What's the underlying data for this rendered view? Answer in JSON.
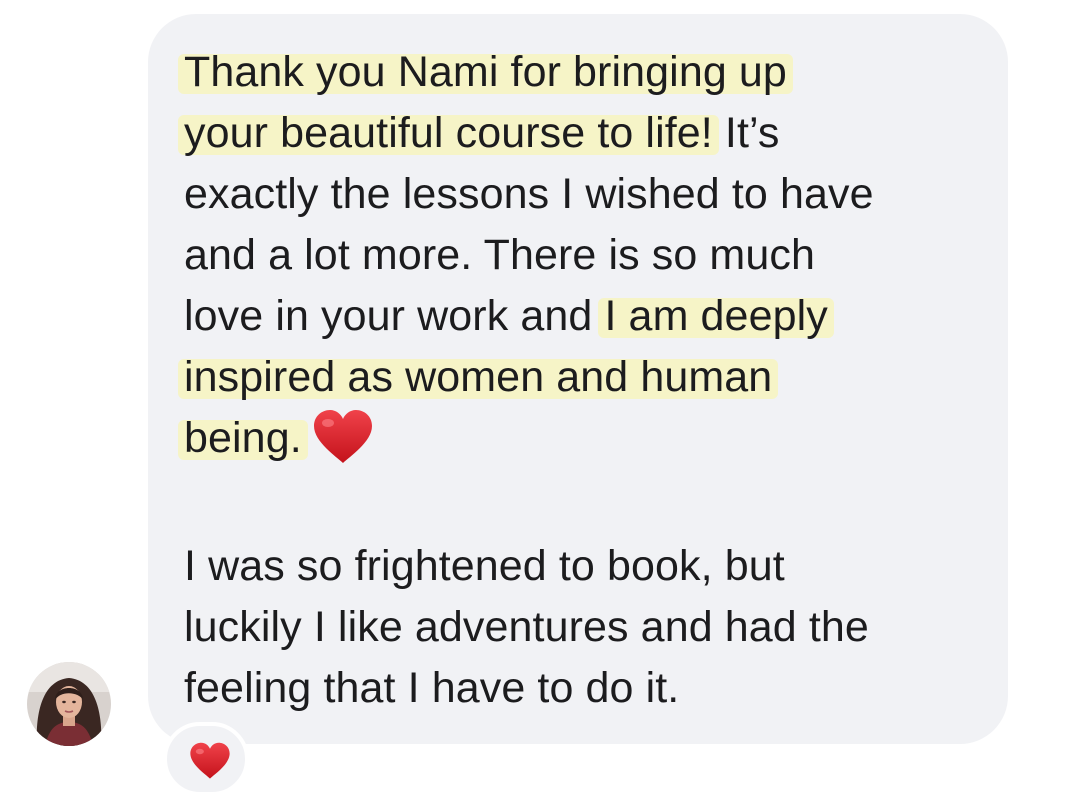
{
  "message": {
    "paragraph1": {
      "line1": "Thank you Nami for bringing up",
      "line2_hl": "your beautiful course to life!",
      "line2_rest": " It’s",
      "line3": "exactly the lessons I wished to have",
      "line4": "and a lot more. There is so much",
      "line5_plain": "love in your work and ",
      "line5_hl": "I am deeply",
      "line6": "inspired as women and human",
      "line7": "being."
    },
    "paragraph2": {
      "line1": "I was so frightened to book, but",
      "line2": "luckily I like adventures and had the",
      "line3": "feeling that I have to do it."
    }
  },
  "icons": {
    "inline_emoji": "red-heart-icon",
    "reaction": "red-heart-icon",
    "avatar": "profile-photo"
  },
  "colors": {
    "bubble": "#f1f2f5",
    "text": "#1c1c1e",
    "highlight": "#f5f3c4",
    "heart": "#e01b24"
  }
}
